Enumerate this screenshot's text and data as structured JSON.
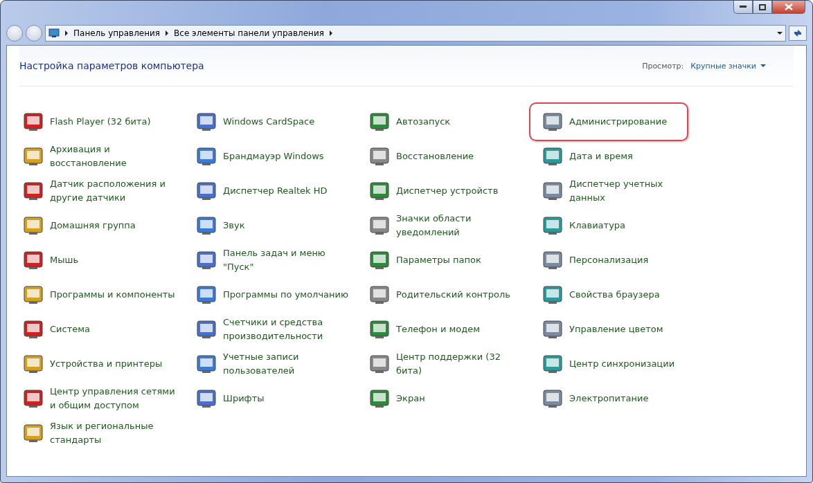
{
  "address_bar": {
    "crumbs": [
      "Панель управления",
      "Все элементы панели управления"
    ]
  },
  "header": {
    "title": "Настройка параметров компьютера",
    "view_label": "Просмотр:",
    "view_value": "Крупные значки"
  },
  "items": [
    {
      "label": "Flash Player (32 бита)",
      "highlighted": false
    },
    {
      "label": "Windows CardSpace",
      "highlighted": false
    },
    {
      "label": "Автозапуск",
      "highlighted": false
    },
    {
      "label": "Администрирование",
      "highlighted": true
    },
    {
      "label": "Архивация и восстановление",
      "highlighted": false
    },
    {
      "label": "Брандмауэр Windows",
      "highlighted": false
    },
    {
      "label": "Восстановление",
      "highlighted": false
    },
    {
      "label": "Дата и время",
      "highlighted": false
    },
    {
      "label": "Датчик расположения и другие датчики",
      "highlighted": false
    },
    {
      "label": "Диспетчер Realtek HD",
      "highlighted": false
    },
    {
      "label": "Диспетчер устройств",
      "highlighted": false
    },
    {
      "label": "Диспетчер учетных данных",
      "highlighted": false
    },
    {
      "label": "Домашняя группа",
      "highlighted": false
    },
    {
      "label": "Звук",
      "highlighted": false
    },
    {
      "label": "Значки области уведомлений",
      "highlighted": false
    },
    {
      "label": "Клавиатура",
      "highlighted": false
    },
    {
      "label": "Мышь",
      "highlighted": false
    },
    {
      "label": "Панель задач и меню \"Пуск\"",
      "highlighted": false
    },
    {
      "label": "Параметры папок",
      "highlighted": false
    },
    {
      "label": "Персонализация",
      "highlighted": false
    },
    {
      "label": "Программы и компоненты",
      "highlighted": false
    },
    {
      "label": "Программы по умолчанию",
      "highlighted": false
    },
    {
      "label": "Родительский контроль",
      "highlighted": false
    },
    {
      "label": "Свойства браузера",
      "highlighted": false
    },
    {
      "label": "Система",
      "highlighted": false
    },
    {
      "label": "Счетчики и средства производительности",
      "highlighted": false
    },
    {
      "label": "Телефон и модем",
      "highlighted": false
    },
    {
      "label": "Управление цветом",
      "highlighted": false
    },
    {
      "label": "Устройства и принтеры",
      "highlighted": false
    },
    {
      "label": "Учетные записи пользователей",
      "highlighted": false
    },
    {
      "label": "Центр поддержки (32 бита)",
      "highlighted": false
    },
    {
      "label": "Центр синхронизации",
      "highlighted": false
    },
    {
      "label": "Центр управления сетями и общим доступом",
      "highlighted": false
    },
    {
      "label": "Шрифты",
      "highlighted": false
    },
    {
      "label": "Экран",
      "highlighted": false
    },
    {
      "label": "Электропитание",
      "highlighted": false
    },
    {
      "label": "Язык и региональные стандарты",
      "highlighted": false
    }
  ]
}
